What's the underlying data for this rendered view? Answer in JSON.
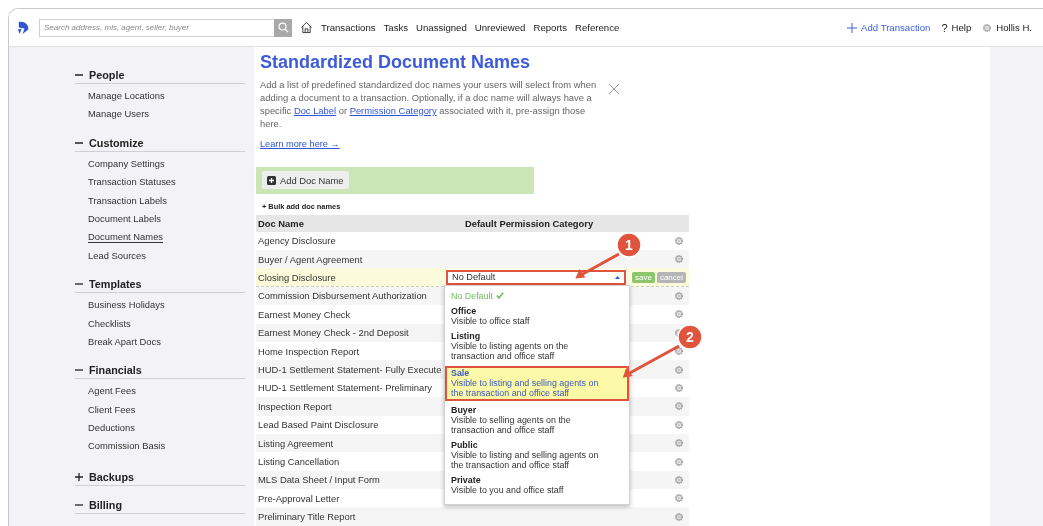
{
  "search": {
    "placeholder": "Search address, mls, agent, seller, buyer"
  },
  "nav": [
    "Transactions",
    "Tasks",
    "Unassigned",
    "Unreviewed",
    "Reports",
    "Reference"
  ],
  "actions": [
    {
      "kind": "add",
      "label": "Add Transaction"
    },
    {
      "kind": "help",
      "icon": "?",
      "label": "Help"
    },
    {
      "kind": "user",
      "label": "Hollis H."
    }
  ],
  "sidebar": {
    "sections": [
      {
        "title": "People",
        "expanded": true,
        "items": [
          {
            "label": "Manage Locations",
            "selected": false
          },
          {
            "label": "Manage Users",
            "selected": false
          }
        ]
      },
      {
        "title": "Customize",
        "expanded": true,
        "items": [
          {
            "label": "Company Settings",
            "selected": false
          },
          {
            "label": "Transaction Statuses",
            "selected": false
          },
          {
            "label": "Transaction Labels",
            "selected": false
          },
          {
            "label": "Document Labels",
            "selected": false
          },
          {
            "label": "Document Names",
            "selected": true
          },
          {
            "label": "Lead Sources",
            "selected": false
          }
        ]
      },
      {
        "title": "Templates",
        "expanded": true,
        "items": [
          {
            "label": "Business Holidays",
            "selected": false
          },
          {
            "label": "Checklists",
            "selected": false
          },
          {
            "label": "Break Apart Docs",
            "selected": false
          }
        ]
      },
      {
        "title": "Financials",
        "expanded": true,
        "items": [
          {
            "label": "Agent Fees",
            "selected": false
          },
          {
            "label": "Client Fees",
            "selected": false
          },
          {
            "label": "Deductions",
            "selected": false
          },
          {
            "label": "Commission Basis",
            "selected": false
          }
        ]
      },
      {
        "title": "Backups",
        "expanded": false
      },
      {
        "title": "Billing",
        "expanded": true
      }
    ]
  },
  "page": {
    "title": "Standardized Document Names",
    "description": [
      {
        "kind": "text",
        "text": "Add a list of predefined standardized doc names your users will select from when adding a document to a transaction. Optionally, if a doc name will always have a specific "
      },
      {
        "kind": "link",
        "text": "Doc Label"
      },
      {
        "kind": "text",
        "text": " or "
      },
      {
        "kind": "link",
        "text": "Permission Category"
      },
      {
        "kind": "text",
        "text": " associated with it, pre-assign those here."
      }
    ],
    "learn_more": "Learn more here →",
    "add_button": "Add Doc Name",
    "bulk_add": "+ Bulk add doc names"
  },
  "table": {
    "columns": [
      "Doc Name",
      "Default Permission Category"
    ],
    "rows": [
      {
        "name": "Agency Disclosure",
        "editing": false
      },
      {
        "name": "Buyer / Agent Agreement",
        "editing": false
      },
      {
        "name": "Closing Disclosure",
        "editing": true
      },
      {
        "name": "Commission Disbursement Authorization",
        "editing": false
      },
      {
        "name": "Earnest Money Check",
        "editing": false
      },
      {
        "name": "Earnest Money Check - 2nd Deposit",
        "editing": false
      },
      {
        "name": "Home Inspection Report",
        "editing": false
      },
      {
        "name": "HUD-1 Settlement Statement- Fully Execute",
        "editing": false
      },
      {
        "name": "HUD-1 Settlement Statement- Preliminary",
        "editing": false
      },
      {
        "name": "Inspection Report",
        "editing": false
      },
      {
        "name": "Lead Based Paint Disclosure",
        "editing": false
      },
      {
        "name": "Listing Agreement",
        "editing": false
      },
      {
        "name": "Listing Cancellation",
        "editing": false
      },
      {
        "name": "MLS Data Sheet / Input Form",
        "editing": false
      },
      {
        "name": "Pre-Approval Letter",
        "editing": false
      },
      {
        "name": "Preliminary Title Report",
        "editing": false
      }
    ]
  },
  "editor": {
    "value": "No Default",
    "save": "save",
    "cancel": "cancel"
  },
  "dropdown": {
    "options": [
      {
        "title": "No Default",
        "selected": true,
        "highlighted": false
      },
      {
        "title": "Office",
        "description": "Visible to office staff",
        "selected": false,
        "highlighted": false
      },
      {
        "title": "Listing",
        "description": "Visible to listing agents on the transaction and office staff",
        "selected": false,
        "highlighted": false
      },
      {
        "title": "Sale",
        "description": "Visible to listing and selling agents on the transaction and office staff",
        "selected": false,
        "highlighted": true
      },
      {
        "title": "Buyer",
        "description": "Visible to selling agents on the transaction and office staff",
        "selected": false,
        "highlighted": false
      },
      {
        "title": "Public",
        "description": "Visible to listing and selling agents on the transaction and office staff",
        "selected": false,
        "highlighted": false
      },
      {
        "title": "Private",
        "description": "Visible to you and office staff",
        "selected": false,
        "highlighted": false
      }
    ]
  },
  "callouts": [
    {
      "label": "1"
    },
    {
      "label": "2"
    }
  ]
}
